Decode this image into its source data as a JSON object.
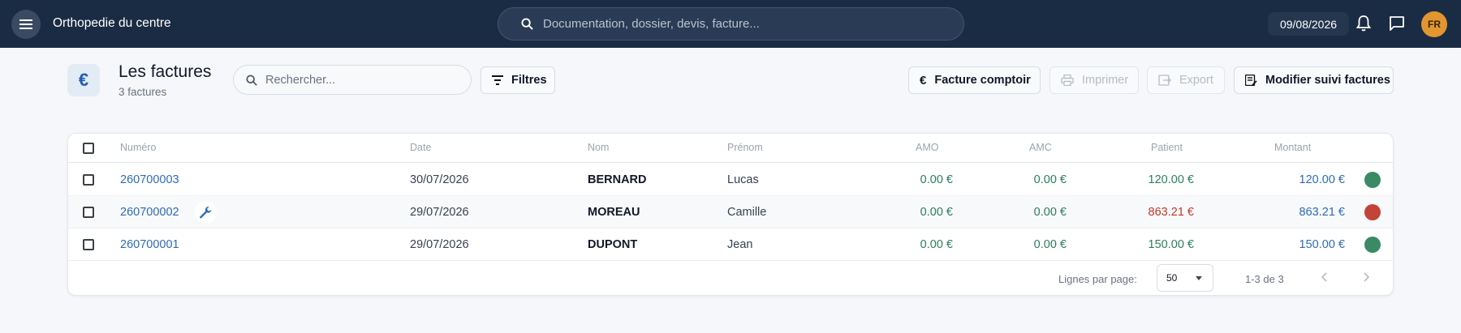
{
  "app": {
    "title": "Orthopedie du centre",
    "menu_icon": "menu-icon"
  },
  "topbar": {
    "search_placeholder": "Documentation, dossier, devis, facture...",
    "date": "09/08/2026",
    "avatar_initials": "FR",
    "colors": {
      "bar": "#1a2b44",
      "avatar": "#e3962f"
    }
  },
  "header": {
    "icon": "euro-icon",
    "title": "Les factures",
    "subtitle": "3 factures",
    "search_placeholder": "Rechercher...",
    "filters_label": "Filtres",
    "comptoir_label": "Facture comptoir",
    "print_label": "Imprimer",
    "export_label": "Export",
    "suivi_label": "Modifier suivi factures"
  },
  "table": {
    "columns": [
      "Numéro",
      "Date",
      "Nom",
      "Prénom",
      "AMO",
      "AMC",
      "Patient",
      "Montant"
    ],
    "rows": [
      {
        "numero": "260700003",
        "date": "30/07/2026",
        "nom": "BERNARD",
        "prenom": "Lucas",
        "amo": "0.00 €",
        "amc": "0.00 €",
        "patient": "120.00 €",
        "montant": "120.00 €",
        "status": "paid",
        "status_color": "#3a8a66",
        "patient_color": "#2e7d5b",
        "has_tool": false
      },
      {
        "numero": "260700002",
        "date": "29/07/2026",
        "nom": "MOREAU",
        "prenom": "Camille",
        "amo": "0.00 €",
        "amc": "0.00 €",
        "patient": "863.21 €",
        "montant": "863.21 €",
        "status": "unpaid",
        "status_color": "#c24338",
        "patient_color": "#c0392b",
        "has_tool": true
      },
      {
        "numero": "260700001",
        "date": "29/07/2026",
        "nom": "DUPONT",
        "prenom": "Jean",
        "amo": "0.00 €",
        "amc": "0.00 €",
        "patient": "150.00 €",
        "montant": "150.00 €",
        "status": "paid",
        "status_color": "#3a8a66",
        "patient_color": "#2e7d5b",
        "has_tool": false
      }
    ]
  },
  "pagination": {
    "rows_label": "Lignes par page:",
    "rows_value": "50",
    "range": "1-3 de 3"
  }
}
